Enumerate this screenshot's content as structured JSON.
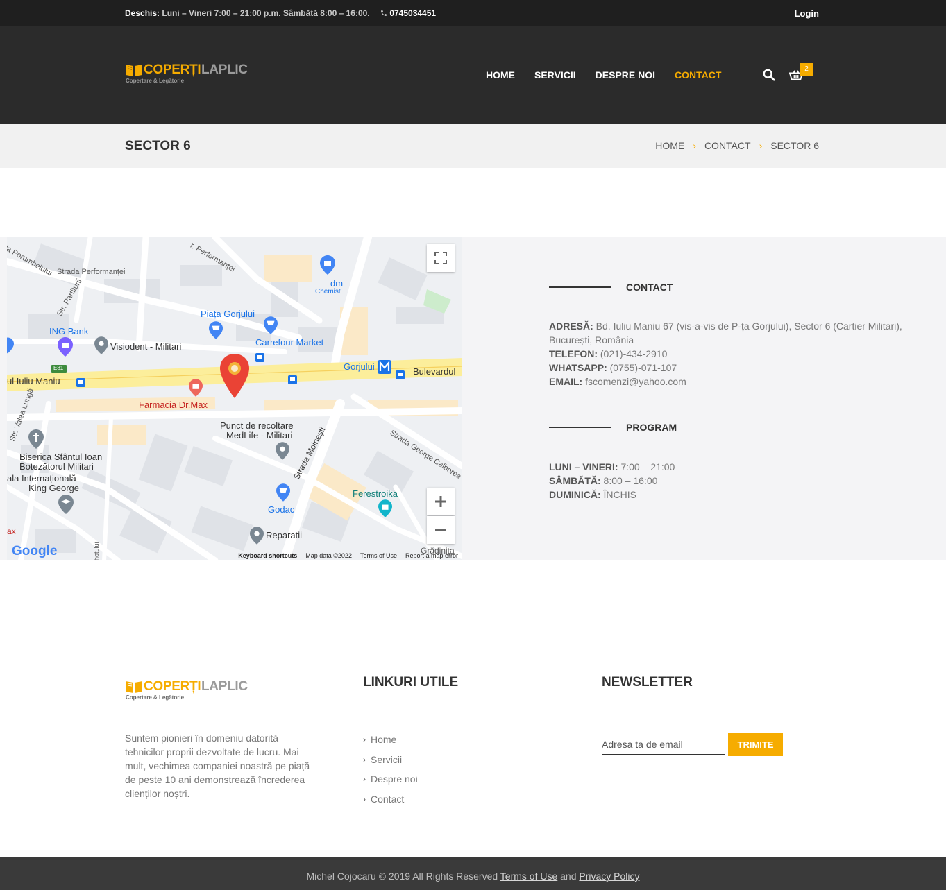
{
  "topbar": {
    "open_label": "Deschis:",
    "hours": "Luni – Vineri 7:00 – 21:00 p.m. Sâmbătă 8:00 – 16:00.",
    "phone": "0745034451",
    "login": "Login"
  },
  "logo": {
    "word1": "COPERȚI",
    "word2": "LAPLIC",
    "tagline": "Copertare & Legătorie"
  },
  "nav": {
    "home": "HOME",
    "services": "SERVICII",
    "about": "DESPRE NOI",
    "contact": "CONTACT"
  },
  "cart": {
    "count": "2"
  },
  "page_title": "SECTOR 6",
  "breadcrumb": {
    "home": "HOME",
    "contact": "CONTACT",
    "current": "SECTOR 6"
  },
  "map": {
    "labels": {
      "porumbelului": "da Porumbelului",
      "performantei_top": "r. Performanței",
      "strada_performantei": "Strada Performanței",
      "str_partiturii": "Str. Partiturii",
      "dm": "dm",
      "chemist": "Chemist",
      "piata": "Piața Gorjului",
      "carrefour": "Carrefour Market",
      "ing": "ING Bank",
      "visiodent": "Visiodent - Militari",
      "e81": "E81",
      "iuliu": "ul Iuliu Maniu",
      "gorjului": "Gorjului",
      "bulevardul": "Bulevardul",
      "farmacia": "Farmacia Dr.Max",
      "valea_lunga": "Str. Valea Lungă",
      "medlife1": "Punct de recoltare",
      "medlife2": "MedLife - Militari",
      "strada_moinesti": "Strada Moinești",
      "george_calboreanu": "Strada George Calborea",
      "biserica1": "Biserica Sfântul Ioan",
      "biserica2": "Botezătorul Militari",
      "scoala1": "ala Internațională",
      "scoala2": "King George",
      "ferestroika": "Ferestroika",
      "godac": "Godac",
      "reparatii": "Reparatii",
      "ax": "ax",
      "gradinita": "Grădinița",
      "hotului": "hotului"
    },
    "google": "Google",
    "keyboard": "Keyboard shortcuts",
    "mapdata": "Map data ©2022",
    "terms": "Terms of Use",
    "report": "Report a map error"
  },
  "contact": {
    "heading": "CONTACT",
    "address_label": "ADRESĂ:",
    "address": "Bd. Iuliu Maniu 67 (vis-a-vis de P-ța Gorjului), Sector 6 (Cartier Militari), București, România",
    "phone_label": "TELEFON:",
    "phone": "(021)-434-2910",
    "whatsapp_label": "WHATSAPP:",
    "whatsapp": "(0755)-071-107",
    "email_label": "EMAIL:",
    "email": "fscomenzi@yahoo.com"
  },
  "program": {
    "heading": "PROGRAM",
    "weekday_label": "LUNI – VINERI:",
    "weekday": "7:00 – 21:00",
    "saturday_label": "SÂMBĂTĂ:",
    "saturday": "8:00 – 16:00",
    "sunday_label": "DUMINICĂ:",
    "sunday": "ÎNCHIS"
  },
  "footer": {
    "about": "Suntem pionieri în domeniu datorită tehnicilor proprii dezvoltate de lucru. Mai mult, vechimea companiei noastră pe piață de peste 10 ani demonstrează încrederea clienților noștri.",
    "links_heading": "LINKURI UTILE",
    "links": [
      "Home",
      "Servicii",
      "Despre noi",
      "Contact"
    ],
    "newsletter_heading": "NEWSLETTER",
    "email_placeholder": "Adresa ta de email",
    "submit": "TRIMITE",
    "copyright": "Michel Cojocaru © 2019 All Rights Reserved",
    "terms": "Terms of Use",
    "and": "and",
    "privacy": "Privacy Policy"
  },
  "colors": {
    "accent": "#f6ac00",
    "dark": "#2b2b2b",
    "topbar": "#1f1f1f"
  }
}
